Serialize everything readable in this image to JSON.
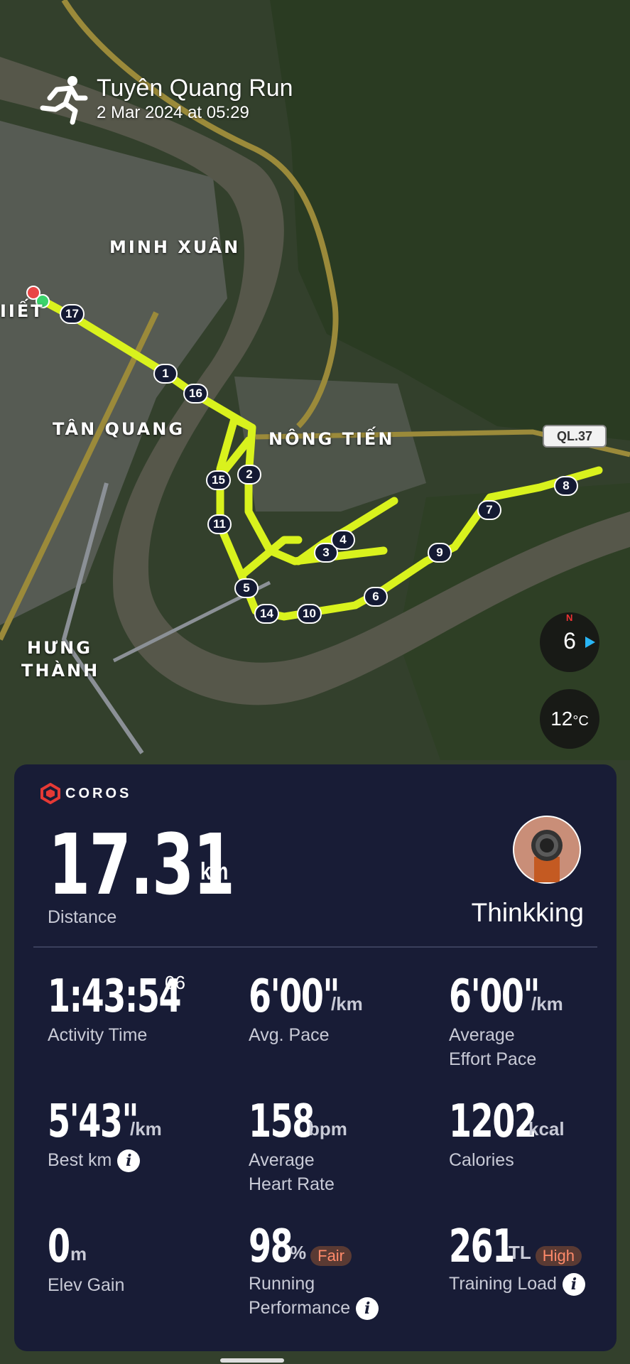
{
  "activity": {
    "title": "Tuyên Quang Run",
    "date": "2 Mar 2024 at 05:29",
    "icon": "running-person-icon"
  },
  "map": {
    "places": [
      "MINH XUÂN",
      "TÂN QUANG",
      "NÔNG TIẾN",
      "HƯNG",
      "THÀNH",
      "IIẾT"
    ],
    "road_shield": "QL.37",
    "km_markers": [
      "17",
      "1",
      "16",
      "15",
      "2",
      "11",
      "3",
      "4",
      "5",
      "14",
      "10",
      "6",
      "9",
      "7",
      "8"
    ],
    "route_color": "#d9f21d",
    "compass_value": "6",
    "temperature": "12",
    "temperature_unit": "°C"
  },
  "card": {
    "brand": "COROS",
    "brand_color": "#e53935",
    "distance": {
      "value": "17.31",
      "unit": "km",
      "label": "Distance"
    },
    "username": "Thinkking",
    "stats": {
      "activity_time": {
        "value": "1:43:54",
        "sup": "06",
        "label": "Activity Time"
      },
      "avg_pace": {
        "value": "6'00\"",
        "unit": "/km",
        "label": "Avg. Pace"
      },
      "effort_pace": {
        "value": "6'00\"",
        "unit": "/km",
        "label1": "Average",
        "label2": "Effort Pace"
      },
      "best_km": {
        "value": "5'43\"",
        "unit": "/km",
        "label": "Best km"
      },
      "heart_rate": {
        "value": "158",
        "unit": "bpm",
        "label1": "Average",
        "label2": "Heart Rate"
      },
      "calories": {
        "value": "1202",
        "unit": "kcal",
        "label": "Calories"
      },
      "elev_gain": {
        "value": "0",
        "unit": "m",
        "label": "Elev Gain"
      },
      "running_perf": {
        "value": "98",
        "unit": "%",
        "badge": "Fair",
        "label1": "Running",
        "label2": "Performance"
      },
      "training_load": {
        "value": "261",
        "unit": "TL",
        "badge": "High",
        "label": "Training Load"
      }
    },
    "info_glyph": "i"
  }
}
